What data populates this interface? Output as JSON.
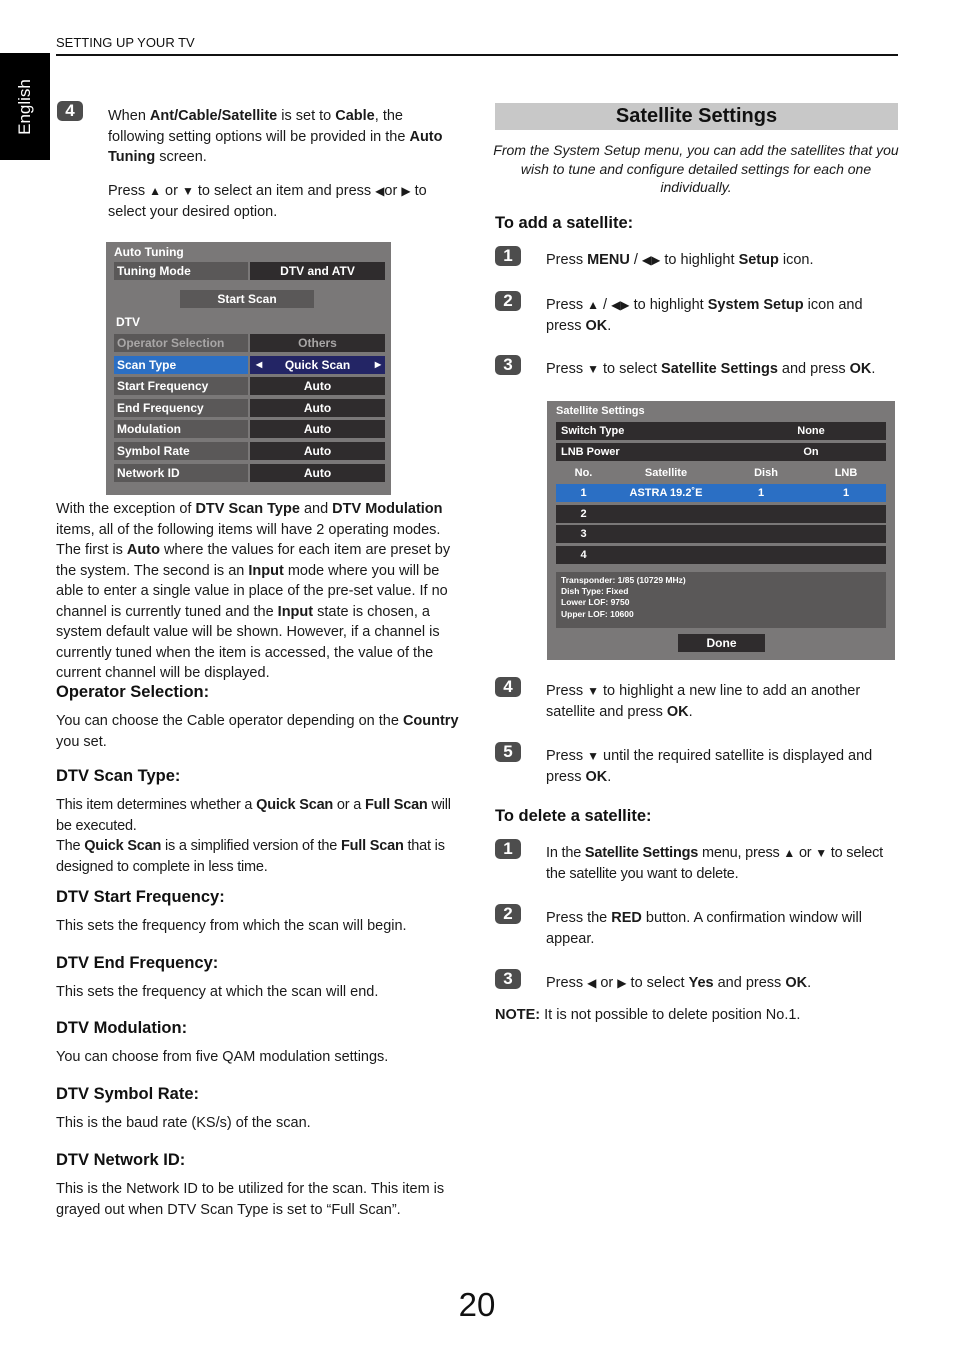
{
  "header": {
    "running_title": "SETTING UP YOUR TV",
    "language_tab": "English"
  },
  "left": {
    "step4": {
      "badge": "4",
      "p1": [
        "When ",
        "Ant/Cable/Satellite",
        " is set to ",
        "Cable",
        ", the following setting options will be provided in the ",
        "Auto Tuning",
        " screen."
      ],
      "p2": [
        "Press ",
        "▲",
        " or ",
        "▼",
        " to select an item and press ",
        "◀",
        "or ",
        "▶",
        " to select your desired option."
      ]
    },
    "auto_tuning_panel": {
      "title": "Auto Tuning",
      "tuning_mode": {
        "label": "Tuning Mode",
        "value": "DTV and ATV"
      },
      "start_scan": "Start Scan",
      "section": "DTV",
      "rows": [
        {
          "label": "Operator Selection",
          "value": "Others",
          "state": "disabled"
        },
        {
          "label": "Scan Type",
          "value": "Quick Scan",
          "state": "selected"
        },
        {
          "label": "Start Frequency",
          "value": "Auto",
          "state": "normal"
        },
        {
          "label": "End Frequency",
          "value": "Auto",
          "state": "normal"
        },
        {
          "label": "Modulation",
          "value": "Auto",
          "state": "normal"
        },
        {
          "label": "Symbol Rate",
          "value": "Auto",
          "state": "normal"
        },
        {
          "label": "Network ID",
          "value": "Auto",
          "state": "normal"
        }
      ],
      "colors": {
        "panel": "#7a7878",
        "label_bg": "#5a5858",
        "value_bg": "#2f2c2d",
        "selected_label": "#2b6fc4",
        "selected_value": "#232565"
      }
    },
    "exception_para": [
      "With the exception of ",
      "DTV Scan Type",
      " and ",
      "DTV Modulation",
      " items, all of the following items will have 2 operating modes. The first is ",
      "Auto",
      " where the values for each item are preset by the system. The second is an ",
      "Input",
      " mode where you will be able to enter a single value in place of the pre-set value. If no channel is currently tuned and the ",
      "Input",
      " state is chosen, a system default value will be shown. However, if a channel is currently tuned when the item is accessed, the value of the current channel will be displayed."
    ],
    "sections": [
      {
        "heading": "Operator Selection:",
        "body": [
          "You can choose the Cable operator depending on the ",
          "Country",
          " you set."
        ]
      },
      {
        "heading": "DTV Scan Type:",
        "body": [
          "This item determines whether a ",
          "Quick Scan",
          " or a ",
          "Full Scan",
          " will be executed.\nThe ",
          "Quick Scan",
          " is a simplified version of the ",
          "Full Scan",
          " that is designed to complete in less time."
        ]
      },
      {
        "heading": "DTV Start Frequency:",
        "body": [
          "This sets the frequency from which the scan will begin."
        ]
      },
      {
        "heading": "DTV End Frequency:",
        "body": [
          "This sets the frequency at which the scan will end."
        ]
      },
      {
        "heading": "DTV Modulation:",
        "body": [
          "You can choose from five QAM modulation settings."
        ]
      },
      {
        "heading": "DTV Symbol Rate:",
        "body": [
          "This is the baud rate (KS/s) of the scan."
        ]
      },
      {
        "heading": "DTV Network ID:",
        "body": [
          "This is the Network ID to be utilized for the scan. This item is grayed out when DTV Scan Type is set to “Full Scan”."
        ]
      }
    ]
  },
  "right": {
    "section_title": "Satellite Settings",
    "intro": "From the System Setup menu, you can add the satellites that you wish to tune and configure detailed settings for each one individually.",
    "add_heading": "To add a satellite:",
    "add_steps": [
      {
        "badge": "1",
        "text": [
          "Press ",
          "MENU",
          " / ",
          "◀▶",
          " to highlight ",
          "Setup",
          " icon."
        ]
      },
      {
        "badge": "2",
        "text": [
          "Press ",
          "▲",
          " / ",
          "◀▶",
          " to highlight ",
          "System Setup",
          " icon and press ",
          "OK",
          "."
        ]
      },
      {
        "badge": "3",
        "text": [
          "Press ",
          "▼",
          " to select ",
          "Satellite Settings",
          " and press ",
          "OK",
          "."
        ]
      },
      {
        "badge": "4",
        "text": [
          "Press ",
          "▼",
          " to highlight a new line to add an another satellite and press ",
          "OK",
          "."
        ]
      },
      {
        "badge": "5",
        "text": [
          "Press ",
          "▼",
          " until the required satellite is displayed and press ",
          "OK",
          "."
        ]
      }
    ],
    "satellite_panel": {
      "title": "Satellite Settings",
      "switch_type": {
        "label": "Switch Type",
        "value": "None"
      },
      "lnb_power": {
        "label": "LNB Power",
        "value": "On"
      },
      "columns": [
        "No.",
        "Satellite",
        "Dish",
        "LNB"
      ],
      "rows": [
        {
          "no": "1",
          "satellite": "ASTRA 19.2˚E",
          "dish": "1",
          "lnb": "1",
          "highlighted": true
        },
        {
          "no": "2",
          "satellite": "",
          "dish": "",
          "lnb": ""
        },
        {
          "no": "3",
          "satellite": "",
          "dish": "",
          "lnb": ""
        },
        {
          "no": "4",
          "satellite": "",
          "dish": "",
          "lnb": ""
        }
      ],
      "info": [
        "Transponder: 1/85 (10729 MHz)",
        "Dish Type: Fixed",
        "Lower LOF: 9750",
        "Upper LOF: 10600"
      ],
      "done": "Done"
    },
    "delete_heading": "To delete a satellite:",
    "delete_steps": [
      {
        "badge": "1",
        "text": [
          "In the ",
          "Satellite Settings",
          " menu, press ",
          "▲",
          " or ",
          "▼",
          " to select the satellite you want to delete."
        ]
      },
      {
        "badge": "2",
        "text": [
          "Press the ",
          "RED",
          " button. A confirmation window will appear."
        ]
      },
      {
        "badge": "3",
        "text": [
          "Press ",
          "◀",
          " or ",
          "▶",
          " to select ",
          "Yes",
          " and press ",
          "OK",
          "."
        ]
      }
    ],
    "note": {
      "label": "NOTE:",
      "text": " It is not possible to delete position No.1."
    }
  },
  "footer": {
    "page_number": "20"
  }
}
